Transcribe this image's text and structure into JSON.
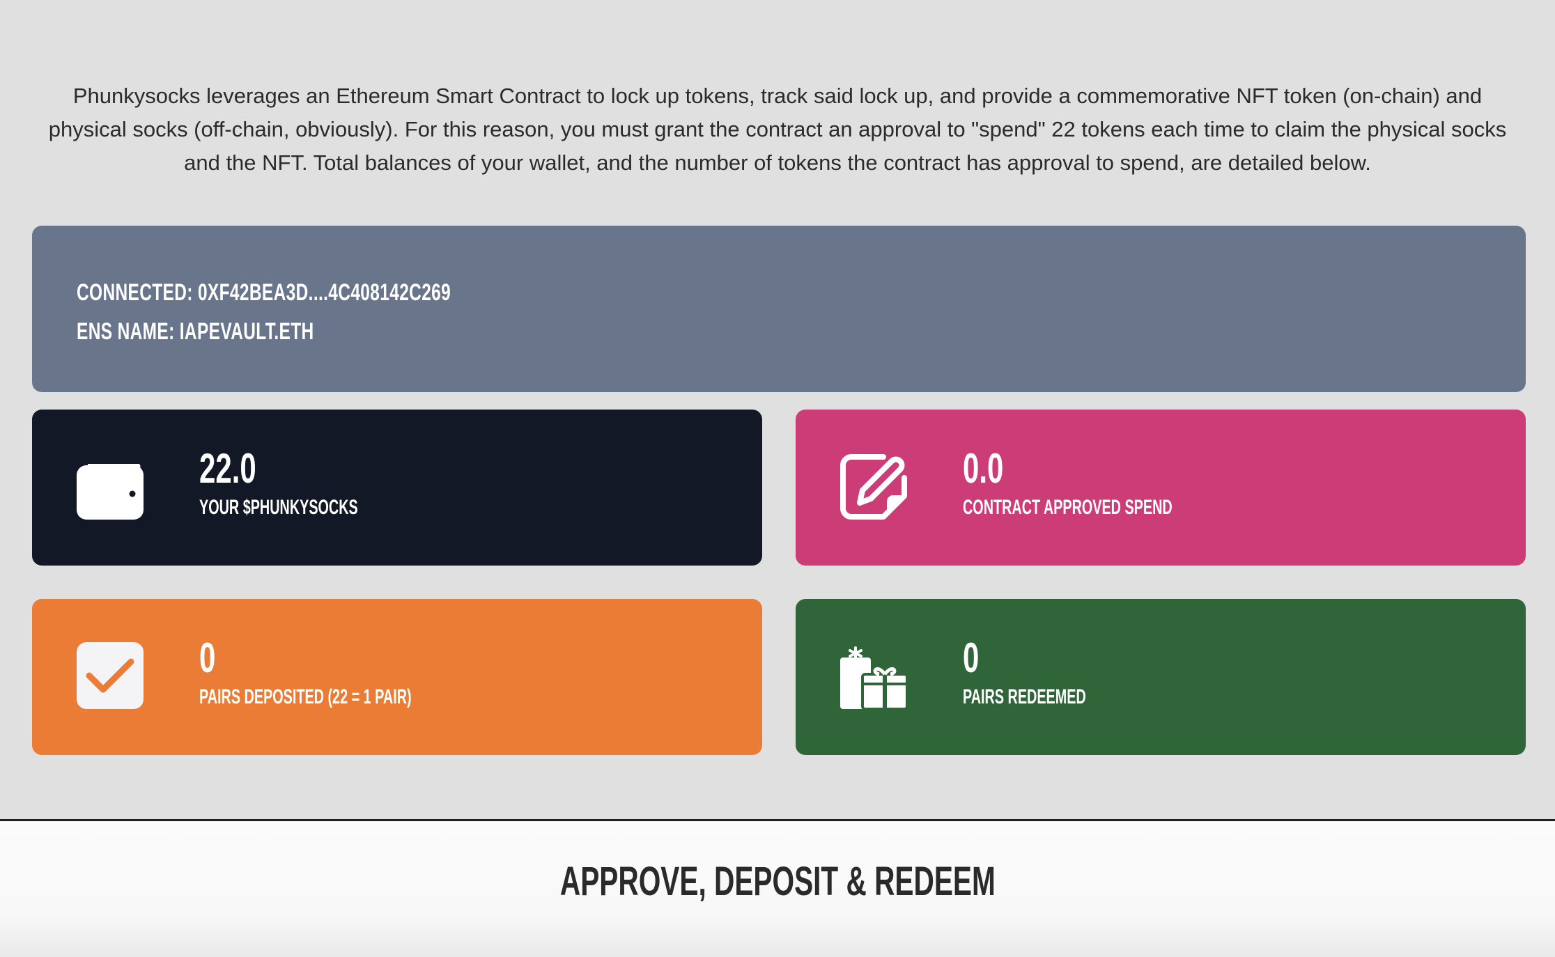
{
  "intro": {
    "text": "Phunkysocks leverages an Ethereum Smart Contract to lock up tokens, track said lock up, and provide a commemorative NFT token (on-chain) and physical socks (off-chain, obviously). For this reason, you must grant the contract an approval to \"spend\" 22 tokens each time to claim the physical socks and the NFT. Total balances of your wallet, and the number of tokens the contract has approval to spend, are detailed below."
  },
  "connection": {
    "connected_line": "Connected: 0xF42bEa3D....4c408142C269",
    "ens_line": "ENS Name: iapevault.eth",
    "background": "#68758b"
  },
  "stats": [
    {
      "value": "22.0",
      "label": "Your $PHUNKYSOCKS",
      "icon": "wallet-icon",
      "color": "#131826"
    },
    {
      "value": "0.0",
      "label": "Contract Approved Spend",
      "icon": "edit-icon",
      "color": "#cc3c76"
    },
    {
      "value": "0",
      "label": "Pairs Deposited (22 = 1 pair)",
      "icon": "checkbox-icon",
      "color": "#eb7c35"
    },
    {
      "value": "0",
      "label": "Pairs Redeemed",
      "icon": "gifts-icon",
      "color": "#30653a"
    }
  ],
  "section": {
    "title": "APPROVE, DEPOSIT & REDEEM"
  }
}
